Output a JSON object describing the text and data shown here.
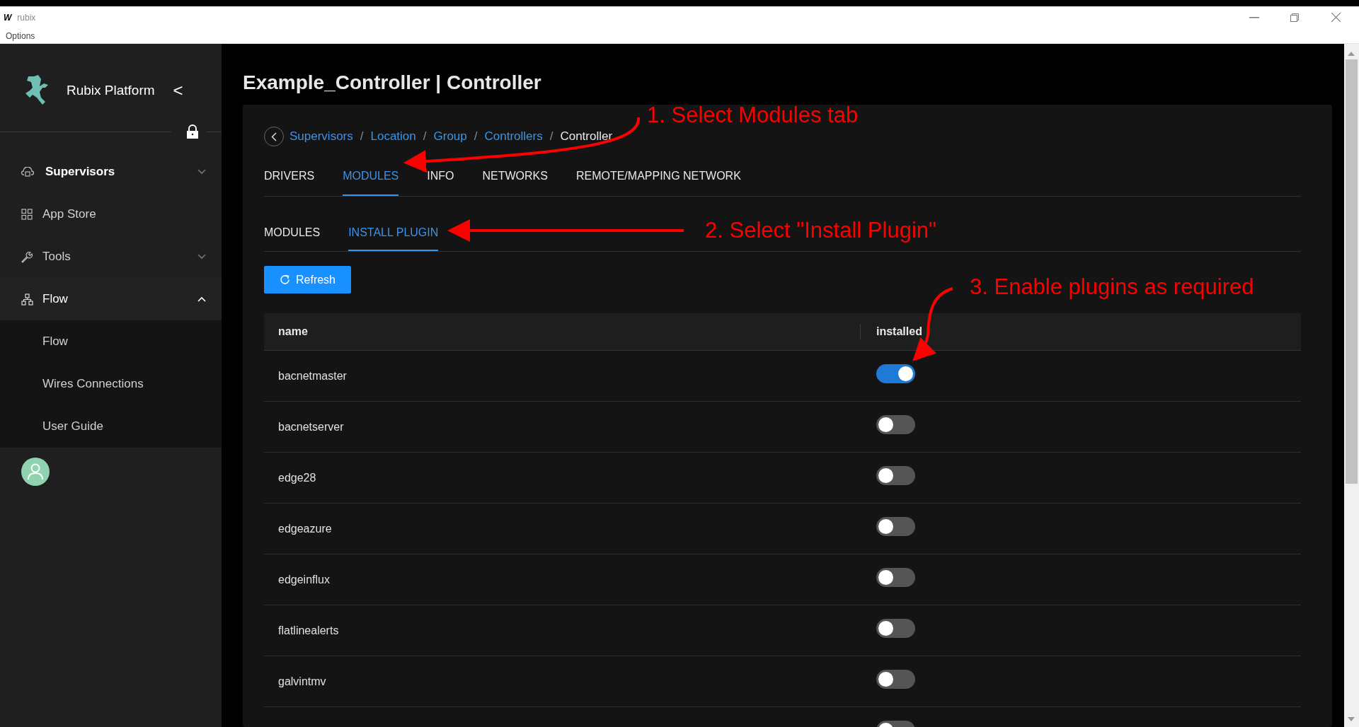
{
  "window": {
    "title": "rubix",
    "app_icon": "W",
    "menu": [
      "Options"
    ]
  },
  "sidebar": {
    "brand": "Rubix Platform",
    "collapse": "<",
    "items": [
      {
        "label": "Supervisors",
        "selected": true,
        "expanded": false,
        "has_children": true
      },
      {
        "label": "App Store",
        "selected": false,
        "expanded": false,
        "has_children": false
      },
      {
        "label": "Tools",
        "selected": false,
        "expanded": false,
        "has_children": true
      },
      {
        "label": "Flow",
        "selected": false,
        "expanded": true,
        "has_children": true,
        "children": [
          {
            "label": "Flow"
          },
          {
            "label": "Wires Connections"
          },
          {
            "label": "User Guide"
          }
        ]
      }
    ]
  },
  "page_title": "Example_Controller | Controller",
  "breadcrumb": [
    {
      "label": "Supervisors",
      "link": true
    },
    {
      "separator": "/",
      "label": "Location",
      "link": true
    },
    {
      "separator": "/",
      "label": "Group",
      "link": true
    },
    {
      "separator": "/",
      "label": "Controllers",
      "link": true
    },
    {
      "separator": "/",
      "label": "Controller",
      "link": false
    }
  ],
  "tabs": [
    {
      "label": "DRIVERS",
      "selected": false
    },
    {
      "label": "MODULES",
      "selected": true
    },
    {
      "label": "INFO",
      "selected": false
    },
    {
      "label": "NETWORKS",
      "selected": false
    },
    {
      "label": "REMOTE/MAPPING NETWORK",
      "selected": false
    }
  ],
  "subtabs": [
    {
      "label": "MODULES",
      "selected": false
    },
    {
      "label": "INSTALL PLUGIN",
      "selected": true
    }
  ],
  "refresh_button": "Refresh",
  "table": {
    "columns": [
      "name",
      "installed"
    ],
    "rows": [
      {
        "name": "bacnetmaster",
        "installed": true
      },
      {
        "name": "bacnetserver",
        "installed": false
      },
      {
        "name": "edge28",
        "installed": false
      },
      {
        "name": "edgeazure",
        "installed": false
      },
      {
        "name": "edgeinflux",
        "installed": false
      },
      {
        "name": "flatlinealerts",
        "installed": false
      },
      {
        "name": "galvintmv",
        "installed": false
      },
      {
        "installed": false
      }
    ]
  },
  "annotations": [
    {
      "text": "1. Select Modules tab"
    },
    {
      "text": "2. Select \"Install Plugin\""
    },
    {
      "text": "3. Enable plugins as required"
    }
  ]
}
